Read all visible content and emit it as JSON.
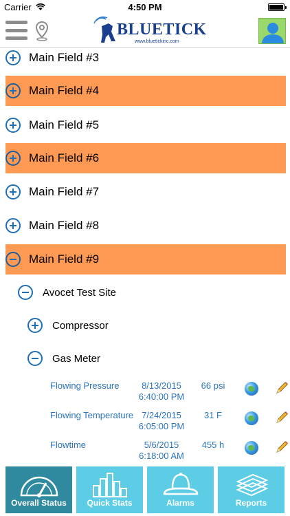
{
  "status_bar": {
    "carrier": "Carrier",
    "time": "4:50 PM"
  },
  "header": {
    "logo_text": "BLUETICK",
    "logo_sub": "www.bluetickinc.com"
  },
  "fields": [
    {
      "label": "Main Field #3",
      "expanded": false,
      "highlighted": false
    },
    {
      "label": "Main Field #4",
      "expanded": false,
      "highlighted": true
    },
    {
      "label": "Main Field #5",
      "expanded": false,
      "highlighted": false
    },
    {
      "label": "Main Field #6",
      "expanded": false,
      "highlighted": true
    },
    {
      "label": "Main Field #7",
      "expanded": false,
      "highlighted": false
    },
    {
      "label": "Main Field #8",
      "expanded": false,
      "highlighted": false
    },
    {
      "label": "Main Field #9",
      "expanded": true,
      "highlighted": true
    }
  ],
  "site": {
    "label": "Avocet Test Site",
    "expanded": true
  },
  "devices": [
    {
      "label": "Compressor",
      "expanded": false
    },
    {
      "label": "Gas Meter",
      "expanded": true
    }
  ],
  "readings": [
    {
      "name": "Flowing Pressure",
      "date": "8/13/2015",
      "time": "6:40:00 PM",
      "value": "66 psi"
    },
    {
      "name": "Flowing Temperature",
      "date": "7/24/2015",
      "time": "6:05:00 PM",
      "value": "31 F"
    },
    {
      "name": "Flowtime",
      "date": "5/6/2015",
      "time": "6:18:00 AM",
      "value": "455 h"
    }
  ],
  "tabs": [
    {
      "label": "Overall Status",
      "icon": "gauge-icon",
      "active": true
    },
    {
      "label": "Quick Stats",
      "icon": "bar-chart-icon",
      "active": false
    },
    {
      "label": "Alarms",
      "icon": "bell-icon",
      "active": false
    },
    {
      "label": "Reports",
      "icon": "stack-icon",
      "active": false
    }
  ],
  "colors": {
    "highlight": "#ff9a55",
    "accent": "#1e6fb5",
    "tab_active": "#2f8aa0",
    "tab_inactive": "#5ccde4"
  }
}
